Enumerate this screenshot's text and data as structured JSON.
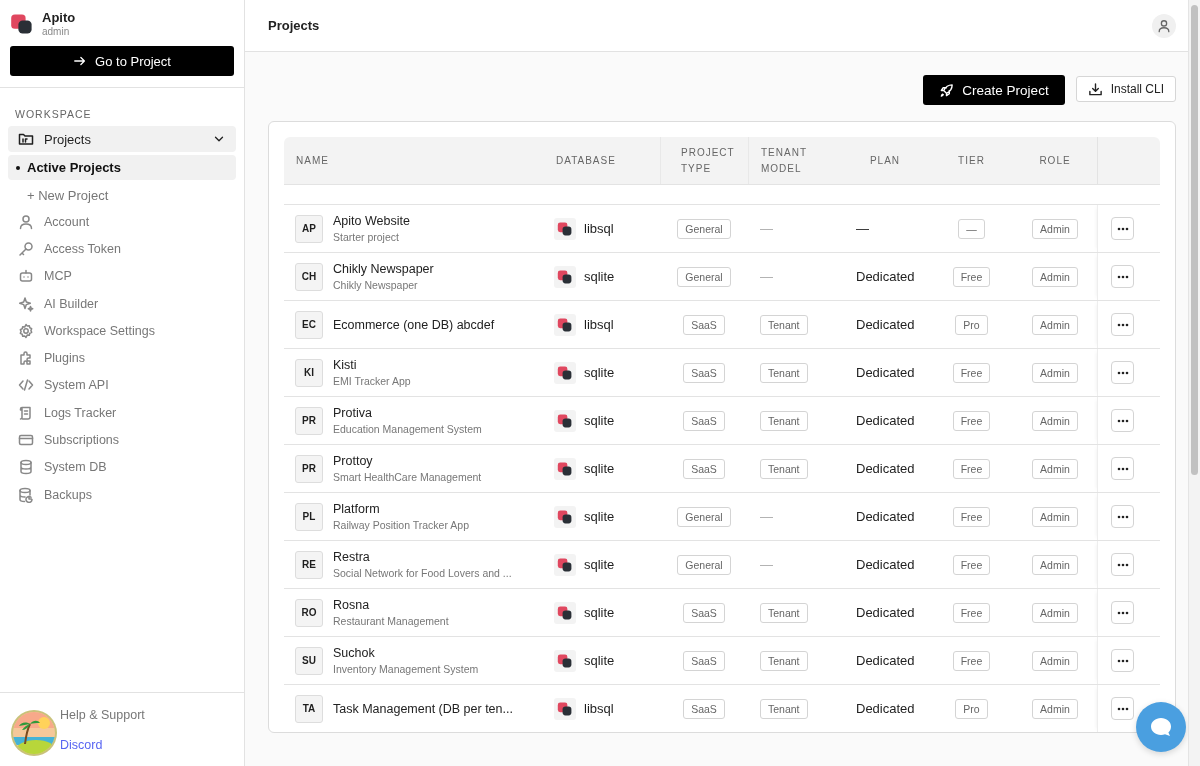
{
  "app": {
    "name": "Apito",
    "role": "admin",
    "go_button": "Go to Project"
  },
  "sidebar": {
    "section": "WORKSPACE",
    "group": {
      "label": "Projects",
      "expanded": true,
      "children": [
        {
          "label": "Active Projects",
          "selected": true,
          "kind": "link"
        },
        {
          "label": "+ New Project",
          "selected": false,
          "kind": "action"
        }
      ]
    },
    "items": [
      {
        "label": "Account",
        "selected": false
      },
      {
        "label": "Access Token",
        "selected": false
      },
      {
        "label": "MCP",
        "selected": false
      },
      {
        "label": "AI Builder",
        "selected": false
      },
      {
        "label": "Workspace Settings",
        "selected": false
      },
      {
        "label": "Plugins",
        "selected": false
      },
      {
        "label": "System API",
        "selected": false
      },
      {
        "label": "Logs Tracker",
        "selected": false
      },
      {
        "label": "Subscriptions",
        "selected": false
      },
      {
        "label": "System DB",
        "selected": false
      },
      {
        "label": "Backups",
        "selected": false
      }
    ],
    "footer": {
      "help": "Help & Support",
      "link": "Discord"
    }
  },
  "header": {
    "title": "Projects"
  },
  "toolbar": {
    "buttons": [
      {
        "label": "Create Project",
        "kind": "primary"
      },
      {
        "label": "Install CLI",
        "kind": "secondary"
      }
    ]
  },
  "table": {
    "columns": [
      "NAME",
      "DATABASE",
      "PROJECT TYPE",
      "TENANT MODEL",
      "PLAN",
      "TIER",
      "ROLE"
    ],
    "rows": [
      {
        "initials": "AP",
        "name": "Apito Website",
        "description": "Starter project",
        "database": "libsql",
        "project_type": "General",
        "tenant_model": {
          "text": "—",
          "kind": "plain"
        },
        "plan": "—",
        "tier": "—",
        "role": "Admin"
      },
      {
        "initials": "CH",
        "name": "Chikly Newspaper",
        "description": "Chikly Newspaper",
        "database": "sqlite",
        "project_type": "General",
        "tenant_model": {
          "text": "—",
          "kind": "plain"
        },
        "plan": "Dedicated",
        "tier": "Free",
        "role": "Admin"
      },
      {
        "initials": "EC",
        "name": "Ecommerce (one DB) abcdef",
        "database": "libsql",
        "project_type": "SaaS",
        "tenant_model": {
          "text": "Tenant",
          "kind": "badge"
        },
        "plan": "Dedicated",
        "tier": "Pro",
        "role": "Admin"
      },
      {
        "initials": "KI",
        "name": "Kisti",
        "description": "EMI Tracker App",
        "database": "sqlite",
        "project_type": "SaaS",
        "tenant_model": {
          "text": "Tenant",
          "kind": "badge"
        },
        "plan": "Dedicated",
        "tier": "Free",
        "role": "Admin"
      },
      {
        "initials": "PR",
        "name": "Protiva",
        "description": "Education Management System",
        "database": "sqlite",
        "project_type": "SaaS",
        "tenant_model": {
          "text": "Tenant",
          "kind": "badge"
        },
        "plan": "Dedicated",
        "tier": "Free",
        "role": "Admin"
      },
      {
        "initials": "PR",
        "name": "Prottoy",
        "description": "Smart HealthCare Management",
        "database": "sqlite",
        "project_type": "SaaS",
        "tenant_model": {
          "text": "Tenant",
          "kind": "badge"
        },
        "plan": "Dedicated",
        "tier": "Free",
        "role": "Admin"
      },
      {
        "initials": "PL",
        "name": "Platform",
        "description": "Railway Position Tracker App",
        "database": "sqlite",
        "project_type": "General",
        "tenant_model": {
          "text": "—",
          "kind": "plain"
        },
        "plan": "Dedicated",
        "tier": "Free",
        "role": "Admin"
      },
      {
        "initials": "RE",
        "name": "Restra",
        "description": "Social Network for Food Lovers and ...",
        "database": "sqlite",
        "project_type": "General",
        "tenant_model": {
          "text": "—",
          "kind": "plain"
        },
        "plan": "Dedicated",
        "tier": "Free",
        "role": "Admin"
      },
      {
        "initials": "RO",
        "name": "Rosna",
        "description": "Restaurant Management",
        "database": "sqlite",
        "project_type": "SaaS",
        "tenant_model": {
          "text": "Tenant",
          "kind": "badge"
        },
        "plan": "Dedicated",
        "tier": "Free",
        "role": "Admin"
      },
      {
        "initials": "SU",
        "name": "Suchok",
        "description": "Inventory Management System",
        "database": "sqlite",
        "project_type": "SaaS",
        "tenant_model": {
          "text": "Tenant",
          "kind": "badge"
        },
        "plan": "Dedicated",
        "tier": "Free",
        "role": "Admin"
      },
      {
        "initials": "TA",
        "name": "Task Management (DB per ten...",
        "database": "libsql",
        "project_type": "SaaS",
        "tenant_model": {
          "text": "Tenant",
          "kind": "badge"
        },
        "plan": "Dedicated",
        "tier": "Pro",
        "role": "Admin"
      }
    ]
  }
}
